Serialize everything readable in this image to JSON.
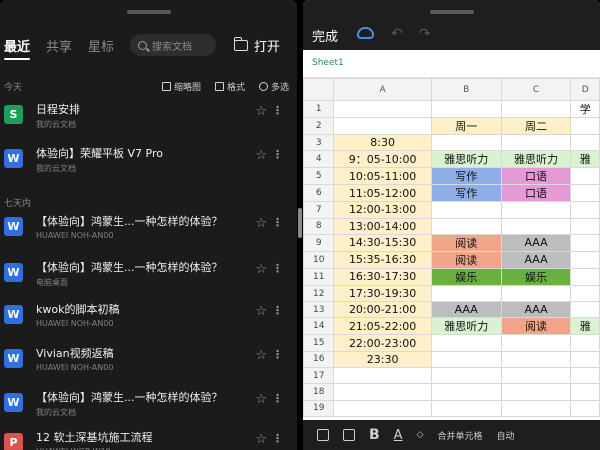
{
  "left": {
    "tabs": [
      "最近",
      "共享",
      "星标"
    ],
    "search_placeholder": "搜索文档",
    "open_label": "打开",
    "sections": {
      "today": "今天",
      "week": "七天内"
    },
    "tools": {
      "thumb": "缩略图",
      "format": "格式",
      "multi": "多选"
    },
    "files": [
      {
        "name": "日程安排",
        "sub": "我的云文档",
        "letter": "S",
        "color": "#1e9e5a"
      },
      {
        "name": "体验向】荣耀平板 V7 Pro",
        "sub": "我的云文档",
        "letter": "W",
        "color": "#2f6fe0"
      },
      {
        "name": "【体验向】鸿蒙生...一种怎样的体验？",
        "sub": "HUAWEI NOH-AN00",
        "letter": "W",
        "color": "#2f6fe0"
      },
      {
        "name": "【体验向】鸿蒙生...一种怎样的体验？",
        "sub": "电脑桌面",
        "letter": "W",
        "color": "#2f6fe0"
      },
      {
        "name": "kwok的脚本初稿",
        "sub": "HUAWEI NOH-AN00",
        "letter": "W",
        "color": "#2f6fe0"
      },
      {
        "name": "Vivian视频返稿",
        "sub": "HUAWEI NOH-AN00",
        "letter": "W",
        "color": "#2f6fe0"
      },
      {
        "name": "【体验向】鸿蒙生...一种怎样的体验？",
        "sub": "我的云文档",
        "letter": "W",
        "color": "#2f6fe0"
      },
      {
        "name": "12 软土深基坑施工流程",
        "sub": "HUAWEI WGR-W19",
        "letter": "P",
        "color": "#d9534f"
      }
    ]
  },
  "right": {
    "done_label": "完成",
    "sheet_name": "Sheet1",
    "columns": [
      "A",
      "B",
      "C",
      "D"
    ],
    "rows": [
      {
        "n": "1",
        "a": "",
        "b": "",
        "c": "",
        "d": "学"
      },
      {
        "n": "2",
        "a": "",
        "b": "周一",
        "c": "周二",
        "d": ""
      },
      {
        "n": "3",
        "a": "8:30",
        "b": "",
        "c": "",
        "d": ""
      },
      {
        "n": "4",
        "a": "9：05-10:00",
        "b": "雅思听力",
        "c": "雅思听力",
        "d": "雅"
      },
      {
        "n": "5",
        "a": "10:05-11:00",
        "b": "写作",
        "c": "口语",
        "d": ""
      },
      {
        "n": "6",
        "a": "11:05-12:00",
        "b": "写作",
        "c": "口语",
        "d": ""
      },
      {
        "n": "7",
        "a": "12:00-13:00",
        "b": "",
        "c": "",
        "d": ""
      },
      {
        "n": "8",
        "a": "13:00-14:00",
        "b": "",
        "c": "",
        "d": ""
      },
      {
        "n": "9",
        "a": "14:30-15:30",
        "b": "阅读",
        "c": "AAA",
        "d": ""
      },
      {
        "n": "10",
        "a": "15:35-16:30",
        "b": "阅读",
        "c": "AAA",
        "d": ""
      },
      {
        "n": "11",
        "a": "16:30-17:30",
        "b": "娱乐",
        "c": "娱乐",
        "d": ""
      },
      {
        "n": "12",
        "a": "17:30-19:30",
        "b": "",
        "c": "",
        "d": ""
      },
      {
        "n": "13",
        "a": "20:00-21:00",
        "b": "AAA",
        "c": "AAA",
        "d": ""
      },
      {
        "n": "14",
        "a": "21:05-22:00",
        "b": "雅思听力",
        "c": "阅读",
        "d": "雅"
      },
      {
        "n": "15",
        "a": "22:00-23:00",
        "b": "",
        "c": "",
        "d": ""
      },
      {
        "n": "16",
        "a": "23:30",
        "b": "",
        "c": "",
        "d": ""
      },
      {
        "n": "17",
        "a": "",
        "b": "",
        "c": "",
        "d": ""
      },
      {
        "n": "18",
        "a": "",
        "b": "",
        "c": "",
        "d": ""
      },
      {
        "n": "19",
        "a": "",
        "b": "",
        "c": "",
        "d": ""
      }
    ],
    "bottom": {
      "merge_label": "合并单元格",
      "auto_label": "自动"
    }
  },
  "colors": {
    "timeA": "#fdf0c8",
    "listen": "#d9f2d0",
    "write": "#8eaee8",
    "oral": "#e59ad6",
    "read": "#f3a58a",
    "aaa": "#bdbdbd",
    "fun": "#6ab040",
    "header": "#fdf0c8"
  }
}
